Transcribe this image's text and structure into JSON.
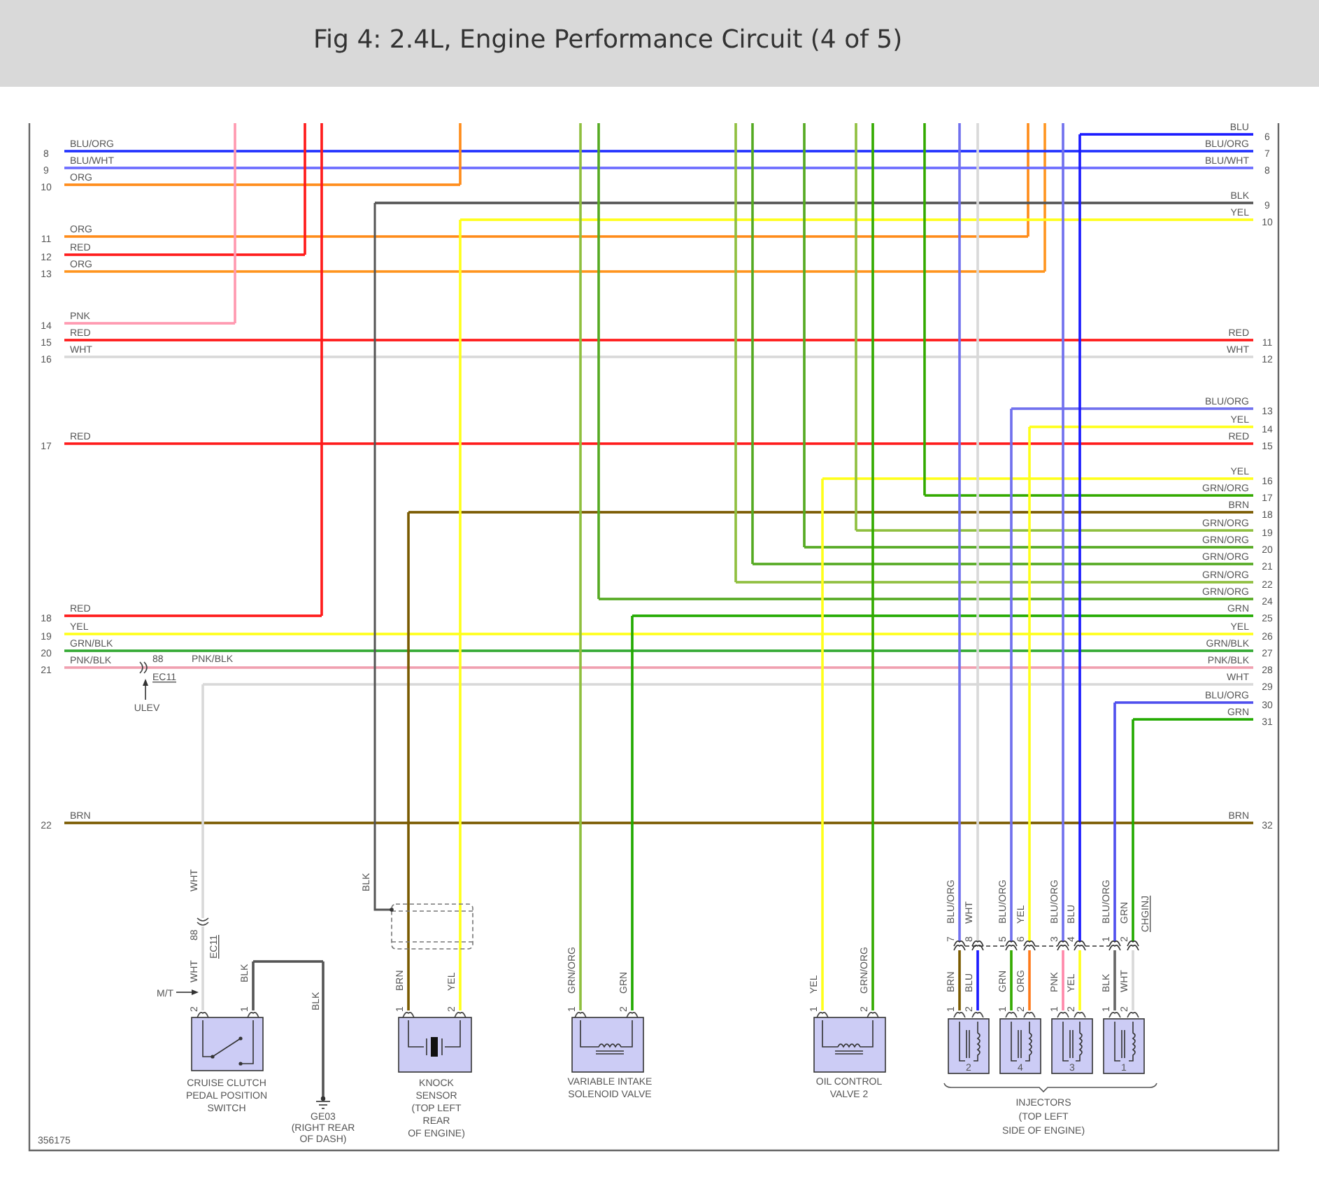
{
  "header": {
    "title": "Fig 4: 2.4L, Engine Performance Circuit (4 of 5)"
  },
  "diagram": {
    "figure_number": "356175",
    "left_wires": [
      {
        "pin": "8",
        "label": "BLU/ORG",
        "color": "#2030ff"
      },
      {
        "pin": "9",
        "label": "BLU/WHT",
        "color": "#6a6aff"
      },
      {
        "pin": "10",
        "label": "ORG",
        "color": "#ff8c1a"
      },
      {
        "pin": "11",
        "label": "ORG",
        "color": "#ff8c1a"
      },
      {
        "pin": "12",
        "label": "RED",
        "color": "#ff1a1a"
      },
      {
        "pin": "13",
        "label": "ORG",
        "color": "#ff951f"
      },
      {
        "pin": "14",
        "label": "PNK",
        "color": "#ff99b0"
      },
      {
        "pin": "15",
        "label": "RED",
        "color": "#ff1a1a"
      },
      {
        "pin": "16",
        "label": "WHT",
        "color": "#d9d9d9"
      },
      {
        "pin": "17",
        "label": "RED",
        "color": "#ff1a1a"
      },
      {
        "pin": "18",
        "label": "RED",
        "color": "#ff1a1a"
      },
      {
        "pin": "19",
        "label": "YEL",
        "color": "#ffff1a"
      },
      {
        "pin": "20",
        "label": "GRN/BLK",
        "color": "#33aa33"
      },
      {
        "pin": "21",
        "label": "PNK/BLK",
        "color": "#f0a0b0"
      },
      {
        "pin": "22",
        "label": "BRN",
        "color": "#7a5a00"
      }
    ],
    "right_wires": [
      {
        "pin": "6",
        "label": "BLU",
        "color": "#1a1aff"
      },
      {
        "pin": "7",
        "label": "BLU/ORG",
        "color": "#2030ff"
      },
      {
        "pin": "8",
        "label": "BLU/WHT",
        "color": "#6a6aff"
      },
      {
        "pin": "9",
        "label": "BLK",
        "color": "#555555"
      },
      {
        "pin": "10",
        "label": "YEL",
        "color": "#ffff1a"
      },
      {
        "pin": "11",
        "label": "RED",
        "color": "#ff1a1a"
      },
      {
        "pin": "12",
        "label": "WHT",
        "color": "#d9d9d9"
      },
      {
        "pin": "13",
        "label": "BLU/ORG",
        "color": "#7070ee"
      },
      {
        "pin": "14",
        "label": "YEL",
        "color": "#ffff1a"
      },
      {
        "pin": "15",
        "label": "RED",
        "color": "#ff1a1a"
      },
      {
        "pin": "16",
        "label": "YEL",
        "color": "#ffff1a"
      },
      {
        "pin": "17",
        "label": "GRN/ORG",
        "color": "#33aa00"
      },
      {
        "pin": "18",
        "label": "BRN",
        "color": "#7a5a00"
      },
      {
        "pin": "19",
        "label": "GRN/ORG",
        "color": "#8fbf3f"
      },
      {
        "pin": "20",
        "label": "GRN/ORG",
        "color": "#55aa22"
      },
      {
        "pin": "21",
        "label": "GRN/ORG",
        "color": "#55aa22"
      },
      {
        "pin": "22",
        "label": "GRN/ORG",
        "color": "#8fbf3f"
      },
      {
        "pin": "24",
        "label": "GRN/ORG",
        "color": "#55aa22"
      },
      {
        "pin": "25",
        "label": "GRN",
        "color": "#22aa00"
      },
      {
        "pin": "26",
        "label": "YEL",
        "color": "#ffff1a"
      },
      {
        "pin": "27",
        "label": "GRN/BLK",
        "color": "#33aa33"
      },
      {
        "pin": "28",
        "label": "PNK/BLK",
        "color": "#f0a0b0"
      },
      {
        "pin": "29",
        "label": "WHT",
        "color": "#d9d9d9"
      },
      {
        "pin": "30",
        "label": "BLU/ORG",
        "color": "#5050ee"
      },
      {
        "pin": "31",
        "label": "GRN",
        "color": "#22aa00"
      },
      {
        "pin": "32",
        "label": "BRN",
        "color": "#7a5a00"
      }
    ],
    "inline_connector": {
      "pin": "88",
      "name": "EC11",
      "wire": "PNK/BLK",
      "option": "ULEV"
    },
    "cruise_switch": {
      "name_lines": [
        "CRUISE CLUTCH",
        "PEDAL POSITION",
        "SWITCH"
      ],
      "upper_wire": "WHT",
      "connector": {
        "pin": "88",
        "name": "EC11"
      },
      "option": "M/T",
      "pins": [
        {
          "number": "2",
          "wire": "WHT",
          "color": "#d9d9d9"
        },
        {
          "number": "1",
          "wire": "BLK",
          "color": "#555555"
        }
      ]
    },
    "ground": {
      "name": "GE03",
      "location_lines": [
        "(RIGHT REAR",
        "OF DASH)"
      ],
      "wire": "BLK"
    },
    "knock_sensor": {
      "name_lines": [
        "KNOCK",
        "SENSOR",
        "(TOP LEFT",
        "REAR",
        "OF ENGINE)"
      ],
      "shield_wire": "BLK",
      "pins": [
        {
          "number": "1",
          "wire": "BRN",
          "color": "#7a5a00"
        },
        {
          "number": "2",
          "wire": "YEL",
          "color": "#ffff1a"
        }
      ]
    },
    "solenoids": [
      {
        "name_lines": [
          "VARIABLE INTAKE",
          "SOLENOID VALVE"
        ],
        "pins": [
          {
            "number": "1",
            "wire": "GRN/ORG",
            "color": "#8fbf3f"
          },
          {
            "number": "2",
            "wire": "GRN",
            "color": "#22aa00"
          }
        ]
      },
      {
        "name_lines": [
          "OIL CONTROL",
          "VALVE 2"
        ],
        "pins": [
          {
            "number": "1",
            "wire": "YEL",
            "color": "#ffff1a"
          },
          {
            "number": "2",
            "wire": "GRN/ORG",
            "color": "#33aa00"
          }
        ]
      }
    ],
    "injectors": {
      "name_lines": [
        "INJECTORS",
        "(TOP LEFT",
        "SIDE OF ENGINE)"
      ],
      "connector_name": "CHGINJ",
      "units": [
        {
          "number": "2",
          "upper": [
            {
              "pin": "7",
              "wire": "BLU/ORG",
              "color": "#7070ee"
            },
            {
              "pin": "8",
              "wire": "WHT",
              "color": "#d9d9d9"
            }
          ],
          "lower": [
            {
              "pin": "1",
              "wire": "BRN",
              "color": "#7a5a00"
            },
            {
              "pin": "2",
              "wire": "BLU",
              "color": "#1a1aff"
            }
          ]
        },
        {
          "number": "4",
          "upper": [
            {
              "pin": "5",
              "wire": "BLU/ORG",
              "color": "#7070ee"
            },
            {
              "pin": "6",
              "wire": "YEL",
              "color": "#ffff1a"
            }
          ],
          "lower": [
            {
              "pin": "1",
              "wire": "GRN",
              "color": "#33aa00"
            },
            {
              "pin": "2",
              "wire": "ORG",
              "color": "#ff7a1a"
            }
          ]
        },
        {
          "number": "3",
          "upper": [
            {
              "pin": "3",
              "wire": "BLU/ORG",
              "color": "#7070ee"
            },
            {
              "pin": "4",
              "wire": "BLU",
              "color": "#1a1aff"
            }
          ],
          "lower": [
            {
              "pin": "1",
              "wire": "PNK",
              "color": "#ff88aa"
            },
            {
              "pin": "2",
              "wire": "YEL",
              "color": "#ffff1a"
            }
          ]
        },
        {
          "number": "1",
          "upper": [
            {
              "pin": "1",
              "wire": "BLU/ORG",
              "color": "#5050ee"
            },
            {
              "pin": "2",
              "wire": "GRN",
              "color": "#22aa00"
            }
          ],
          "lower": [
            {
              "pin": "1",
              "wire": "BLK",
              "color": "#666666"
            },
            {
              "pin": "2",
              "wire": "WHT",
              "color": "#d9d9d9"
            }
          ]
        }
      ]
    }
  }
}
